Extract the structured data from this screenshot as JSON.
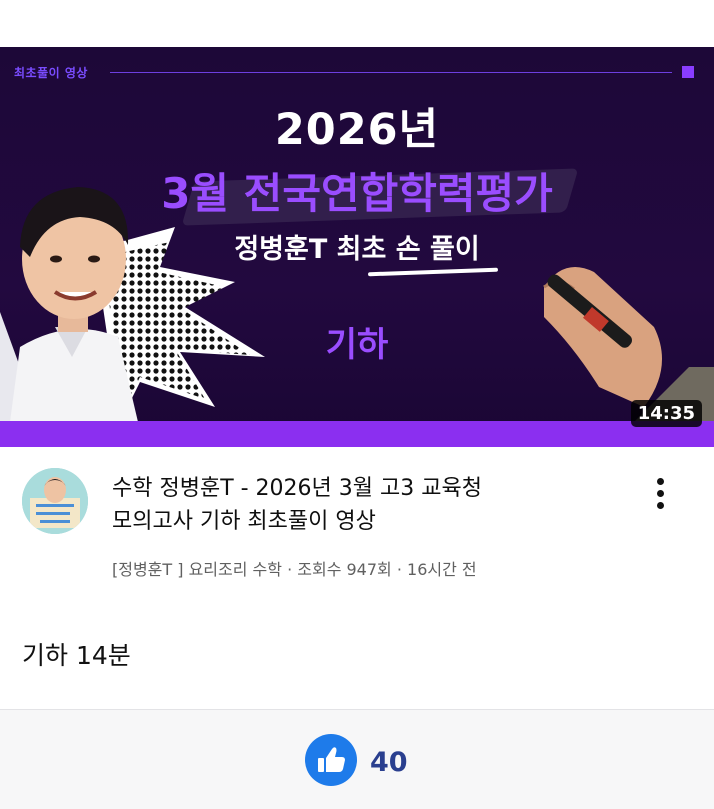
{
  "thumbnail": {
    "caption": "최초풀이 영상",
    "year": "2026년",
    "event": "3월 전국연합학력평가",
    "subtitle": "정병훈T 최초 손 풀이",
    "subject": "기하",
    "duration": "14:35",
    "colors": {
      "background": "#1d0838",
      "accent": "#9a4dff",
      "bar": "#8b2ff0"
    }
  },
  "video": {
    "title_line1": "수학 정병훈T - 2026년 3월 고3 교육청",
    "title_line2": "모의고사 기하 최초풀이 영상",
    "meta": "[정병훈T ] 요리조리 수학 · 조회수 947회 · 16시간 전",
    "more_icon": "vertical-dots-icon"
  },
  "post": {
    "text": "기하 14분"
  },
  "footer": {
    "like_icon": "thumbs-up-icon",
    "like_count": "40",
    "colors": {
      "like": "#1e7bea",
      "count": "#2a3f8f"
    }
  }
}
